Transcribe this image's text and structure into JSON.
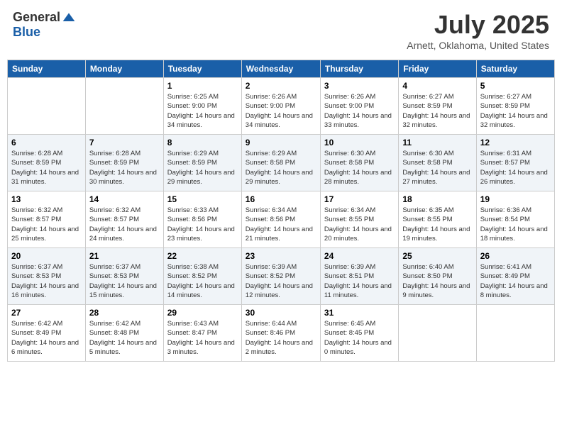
{
  "logo": {
    "general": "General",
    "blue": "Blue"
  },
  "header": {
    "title": "July 2025",
    "subtitle": "Arnett, Oklahoma, United States"
  },
  "weekdays": [
    "Sunday",
    "Monday",
    "Tuesday",
    "Wednesday",
    "Thursday",
    "Friday",
    "Saturday"
  ],
  "weeks": [
    [
      {
        "day": "",
        "info": ""
      },
      {
        "day": "",
        "info": ""
      },
      {
        "day": "1",
        "info": "Sunrise: 6:25 AM\nSunset: 9:00 PM\nDaylight: 14 hours and 34 minutes."
      },
      {
        "day": "2",
        "info": "Sunrise: 6:26 AM\nSunset: 9:00 PM\nDaylight: 14 hours and 34 minutes."
      },
      {
        "day": "3",
        "info": "Sunrise: 6:26 AM\nSunset: 9:00 PM\nDaylight: 14 hours and 33 minutes."
      },
      {
        "day": "4",
        "info": "Sunrise: 6:27 AM\nSunset: 8:59 PM\nDaylight: 14 hours and 32 minutes."
      },
      {
        "day": "5",
        "info": "Sunrise: 6:27 AM\nSunset: 8:59 PM\nDaylight: 14 hours and 32 minutes."
      }
    ],
    [
      {
        "day": "6",
        "info": "Sunrise: 6:28 AM\nSunset: 8:59 PM\nDaylight: 14 hours and 31 minutes."
      },
      {
        "day": "7",
        "info": "Sunrise: 6:28 AM\nSunset: 8:59 PM\nDaylight: 14 hours and 30 minutes."
      },
      {
        "day": "8",
        "info": "Sunrise: 6:29 AM\nSunset: 8:59 PM\nDaylight: 14 hours and 29 minutes."
      },
      {
        "day": "9",
        "info": "Sunrise: 6:29 AM\nSunset: 8:58 PM\nDaylight: 14 hours and 29 minutes."
      },
      {
        "day": "10",
        "info": "Sunrise: 6:30 AM\nSunset: 8:58 PM\nDaylight: 14 hours and 28 minutes."
      },
      {
        "day": "11",
        "info": "Sunrise: 6:30 AM\nSunset: 8:58 PM\nDaylight: 14 hours and 27 minutes."
      },
      {
        "day": "12",
        "info": "Sunrise: 6:31 AM\nSunset: 8:57 PM\nDaylight: 14 hours and 26 minutes."
      }
    ],
    [
      {
        "day": "13",
        "info": "Sunrise: 6:32 AM\nSunset: 8:57 PM\nDaylight: 14 hours and 25 minutes."
      },
      {
        "day": "14",
        "info": "Sunrise: 6:32 AM\nSunset: 8:57 PM\nDaylight: 14 hours and 24 minutes."
      },
      {
        "day": "15",
        "info": "Sunrise: 6:33 AM\nSunset: 8:56 PM\nDaylight: 14 hours and 23 minutes."
      },
      {
        "day": "16",
        "info": "Sunrise: 6:34 AM\nSunset: 8:56 PM\nDaylight: 14 hours and 21 minutes."
      },
      {
        "day": "17",
        "info": "Sunrise: 6:34 AM\nSunset: 8:55 PM\nDaylight: 14 hours and 20 minutes."
      },
      {
        "day": "18",
        "info": "Sunrise: 6:35 AM\nSunset: 8:55 PM\nDaylight: 14 hours and 19 minutes."
      },
      {
        "day": "19",
        "info": "Sunrise: 6:36 AM\nSunset: 8:54 PM\nDaylight: 14 hours and 18 minutes."
      }
    ],
    [
      {
        "day": "20",
        "info": "Sunrise: 6:37 AM\nSunset: 8:53 PM\nDaylight: 14 hours and 16 minutes."
      },
      {
        "day": "21",
        "info": "Sunrise: 6:37 AM\nSunset: 8:53 PM\nDaylight: 14 hours and 15 minutes."
      },
      {
        "day": "22",
        "info": "Sunrise: 6:38 AM\nSunset: 8:52 PM\nDaylight: 14 hours and 14 minutes."
      },
      {
        "day": "23",
        "info": "Sunrise: 6:39 AM\nSunset: 8:52 PM\nDaylight: 14 hours and 12 minutes."
      },
      {
        "day": "24",
        "info": "Sunrise: 6:39 AM\nSunset: 8:51 PM\nDaylight: 14 hours and 11 minutes."
      },
      {
        "day": "25",
        "info": "Sunrise: 6:40 AM\nSunset: 8:50 PM\nDaylight: 14 hours and 9 minutes."
      },
      {
        "day": "26",
        "info": "Sunrise: 6:41 AM\nSunset: 8:49 PM\nDaylight: 14 hours and 8 minutes."
      }
    ],
    [
      {
        "day": "27",
        "info": "Sunrise: 6:42 AM\nSunset: 8:49 PM\nDaylight: 14 hours and 6 minutes."
      },
      {
        "day": "28",
        "info": "Sunrise: 6:42 AM\nSunset: 8:48 PM\nDaylight: 14 hours and 5 minutes."
      },
      {
        "day": "29",
        "info": "Sunrise: 6:43 AM\nSunset: 8:47 PM\nDaylight: 14 hours and 3 minutes."
      },
      {
        "day": "30",
        "info": "Sunrise: 6:44 AM\nSunset: 8:46 PM\nDaylight: 14 hours and 2 minutes."
      },
      {
        "day": "31",
        "info": "Sunrise: 6:45 AM\nSunset: 8:45 PM\nDaylight: 14 hours and 0 minutes."
      },
      {
        "day": "",
        "info": ""
      },
      {
        "day": "",
        "info": ""
      }
    ]
  ]
}
